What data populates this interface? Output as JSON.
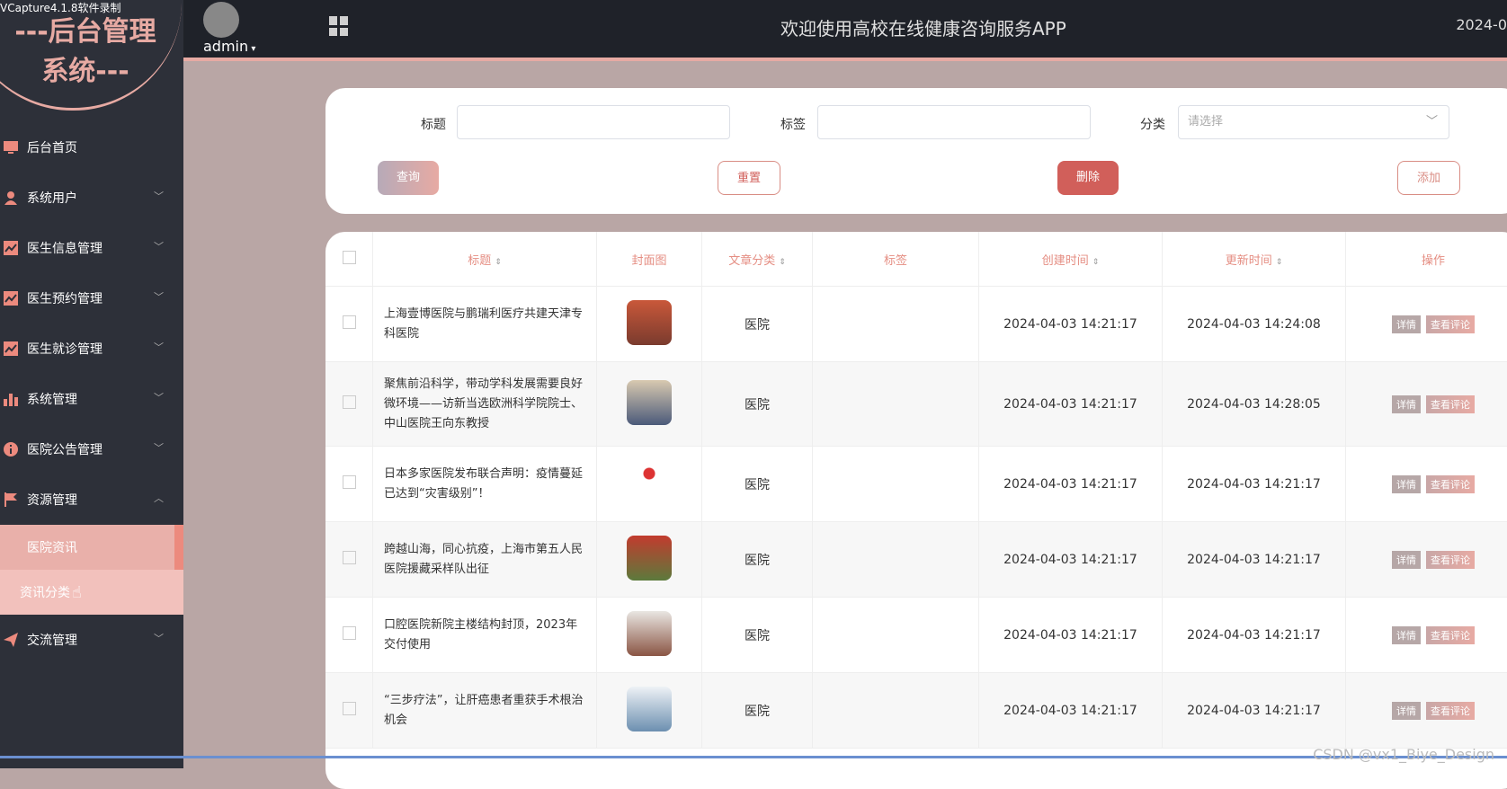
{
  "recording_label": "VCapture4.1.8软件录制",
  "sidebar": {
    "logo_line1": "---后台管理",
    "logo_line2": "系统---",
    "items": [
      {
        "label": "后台首页",
        "icon": "monitor-icon"
      },
      {
        "label": "系统用户",
        "icon": "user-icon"
      },
      {
        "label": "医生信息管理",
        "icon": "chart-icon"
      },
      {
        "label": "医生预约管理",
        "icon": "chart-icon"
      },
      {
        "label": "医生就诊管理",
        "icon": "chart-icon"
      },
      {
        "label": "系统管理",
        "icon": "bar-chart-icon"
      },
      {
        "label": "医院公告管理",
        "icon": "info-icon"
      },
      {
        "label": "资源管理",
        "icon": "flag-icon"
      }
    ],
    "sub_items": [
      "医院资讯",
      "资讯分类"
    ],
    "last_item": {
      "label": "交流管理",
      "icon": "send-icon"
    }
  },
  "header": {
    "user": "admin",
    "welcome": "欢迎使用高校在线健康咨询服务APP",
    "date": "2024-0"
  },
  "search": {
    "title_label": "标题",
    "tag_label": "标签",
    "category_label": "分类",
    "category_placeholder": "请选择",
    "query_btn": "查询",
    "reset_btn": "重置",
    "delete_btn": "删除",
    "add_btn": "添加"
  },
  "table": {
    "headers": [
      "标题",
      "封面图",
      "文章分类",
      "标签",
      "创建时间",
      "更新时间",
      "操作"
    ],
    "detail_btn": "详情",
    "comment_btn": "查看评论",
    "rows": [
      {
        "title": "上海壹博医院与鹏瑞利医疗共建天津专科医院",
        "category": "医院",
        "created": "2024-04-03 14:21:17",
        "updated": "2024-04-03 14:24:08"
      },
      {
        "title": "聚焦前沿科学，带动学科发展需要良好微环境——访新当选欧洲科学院院士、中山医院王向东教授",
        "category": "医院",
        "created": "2024-04-03 14:21:17",
        "updated": "2024-04-03 14:28:05"
      },
      {
        "title": "日本多家医院发布联合声明：疫情蔓延已达到“灾害级别”！",
        "category": "医院",
        "created": "2024-04-03 14:21:17",
        "updated": "2024-04-03 14:21:17"
      },
      {
        "title": "跨越山海，同心抗疫，上海市第五人民医院援藏采样队出征",
        "category": "医院",
        "created": "2024-04-03 14:21:17",
        "updated": "2024-04-03 14:21:17"
      },
      {
        "title": "口腔医院新院主楼结构封顶，2023年交付使用",
        "category": "医院",
        "created": "2024-04-03 14:21:17",
        "updated": "2024-04-03 14:21:17"
      },
      {
        "title": "“三步疗法”，让肝癌患者重获手术根治机会",
        "category": "医院",
        "created": "2024-04-03 14:21:17",
        "updated": "2024-04-03 14:21:17"
      }
    ]
  },
  "watermark": "CSDN @vx1_Biye_Design",
  "colors": {
    "accent": "#e7aaa3",
    "sidebar_bg": "#2d3039",
    "delete": "#d15f5a"
  }
}
